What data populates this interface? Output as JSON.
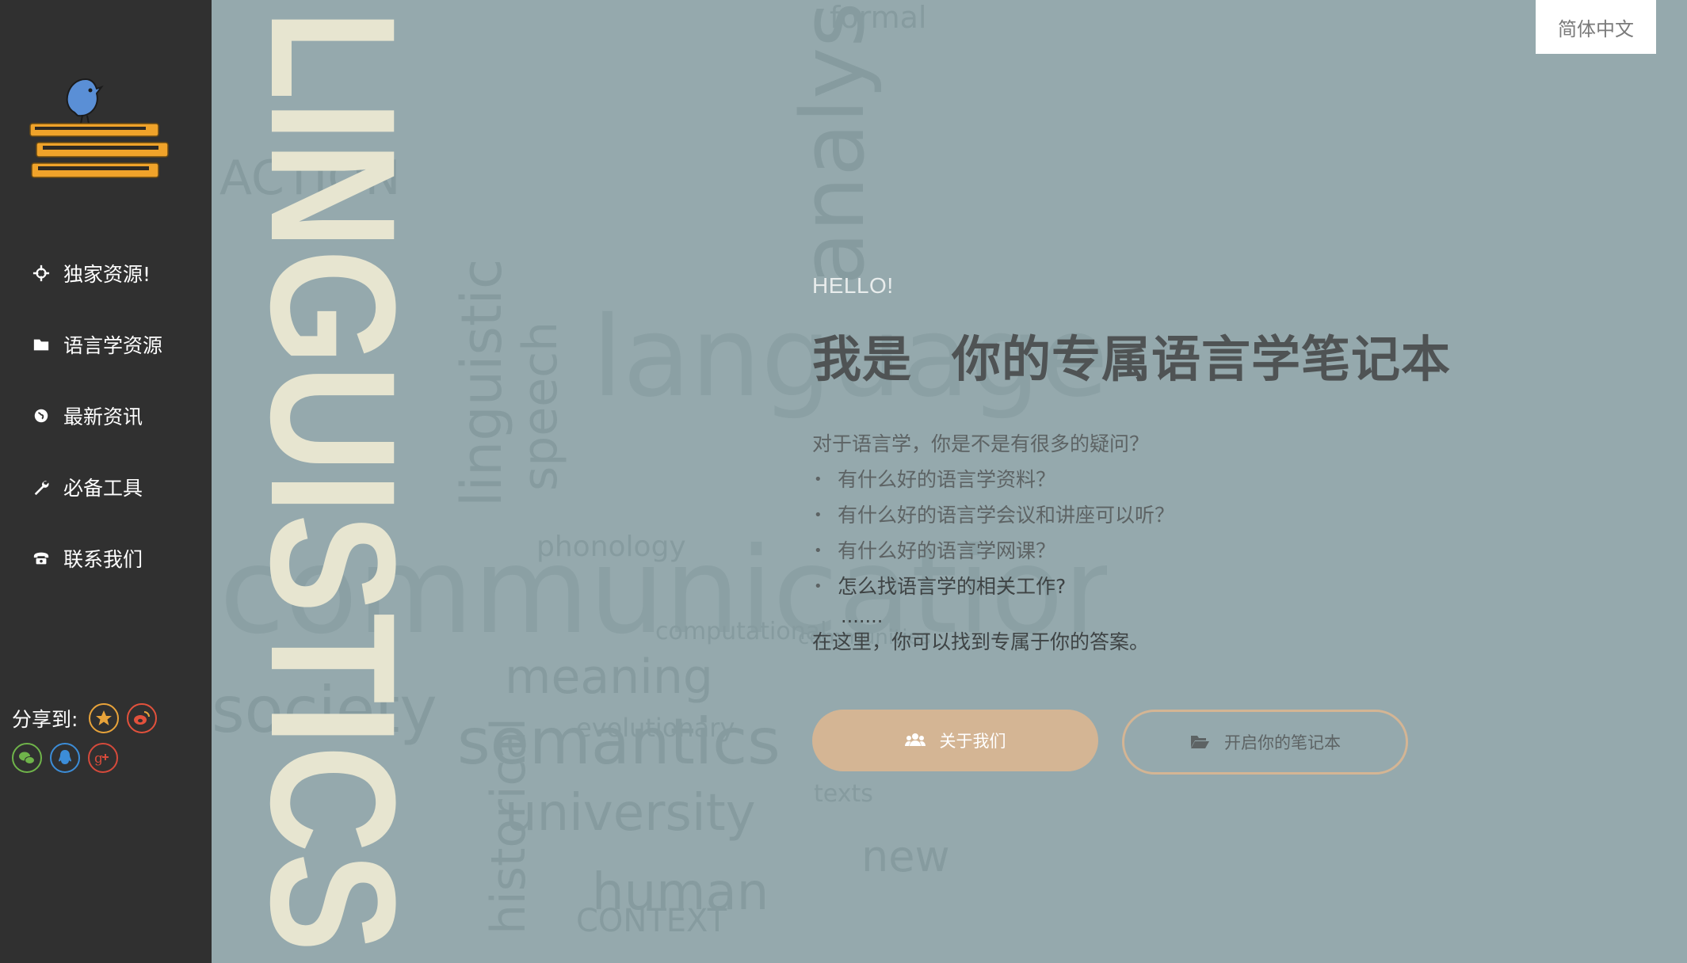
{
  "sidebar": {
    "logo_icon": "bird-on-books-logo",
    "items": [
      {
        "label": "独家资源!",
        "icon": "crosshair-icon"
      },
      {
        "label": "语言学资源",
        "icon": "folder-icon"
      },
      {
        "label": "最新资讯",
        "icon": "globe-icon"
      },
      {
        "label": "必备工具",
        "icon": "wrench-icon"
      },
      {
        "label": "联系我们",
        "icon": "phone-icon"
      }
    ],
    "share": {
      "label": "分享到:",
      "targets": [
        {
          "icon": "star-icon",
          "color": "#e8a33a"
        },
        {
          "icon": "weibo-icon",
          "color": "#e2513c"
        },
        {
          "icon": "wechat-icon",
          "color": "#6fb44a"
        },
        {
          "icon": "qq-icon",
          "color": "#3c8dd8"
        },
        {
          "icon": "google-plus-icon",
          "color": "#d64a3b"
        }
      ]
    }
  },
  "header": {
    "language_button": "简体中文"
  },
  "background": {
    "big_word": "LINGUISTICS",
    "big_word_color": "#e7e5d0"
  },
  "hero": {
    "hello": "HELLO!",
    "headline_part1": "我是",
    "headline_part2": "你的专属语言学笔记本",
    "intro": "对于语言学，你是不是有很多的疑问？",
    "questions": [
      "有什么好的语言学资料？",
      "有什么好的语言学会议和讲座可以听？",
      "有什么好的语言学网课？",
      "怎么找语言学的相关工作?"
    ],
    "ellipsis": ".......",
    "answer": "在这里，你可以找到专属于你的答案。"
  },
  "buttons": {
    "about": "关于我们",
    "open_notebook": "开启你的笔记本"
  },
  "colors": {
    "sidebar_bg": "#303030",
    "hero_bg": "#95a9ad",
    "accent": "#d4b594"
  }
}
